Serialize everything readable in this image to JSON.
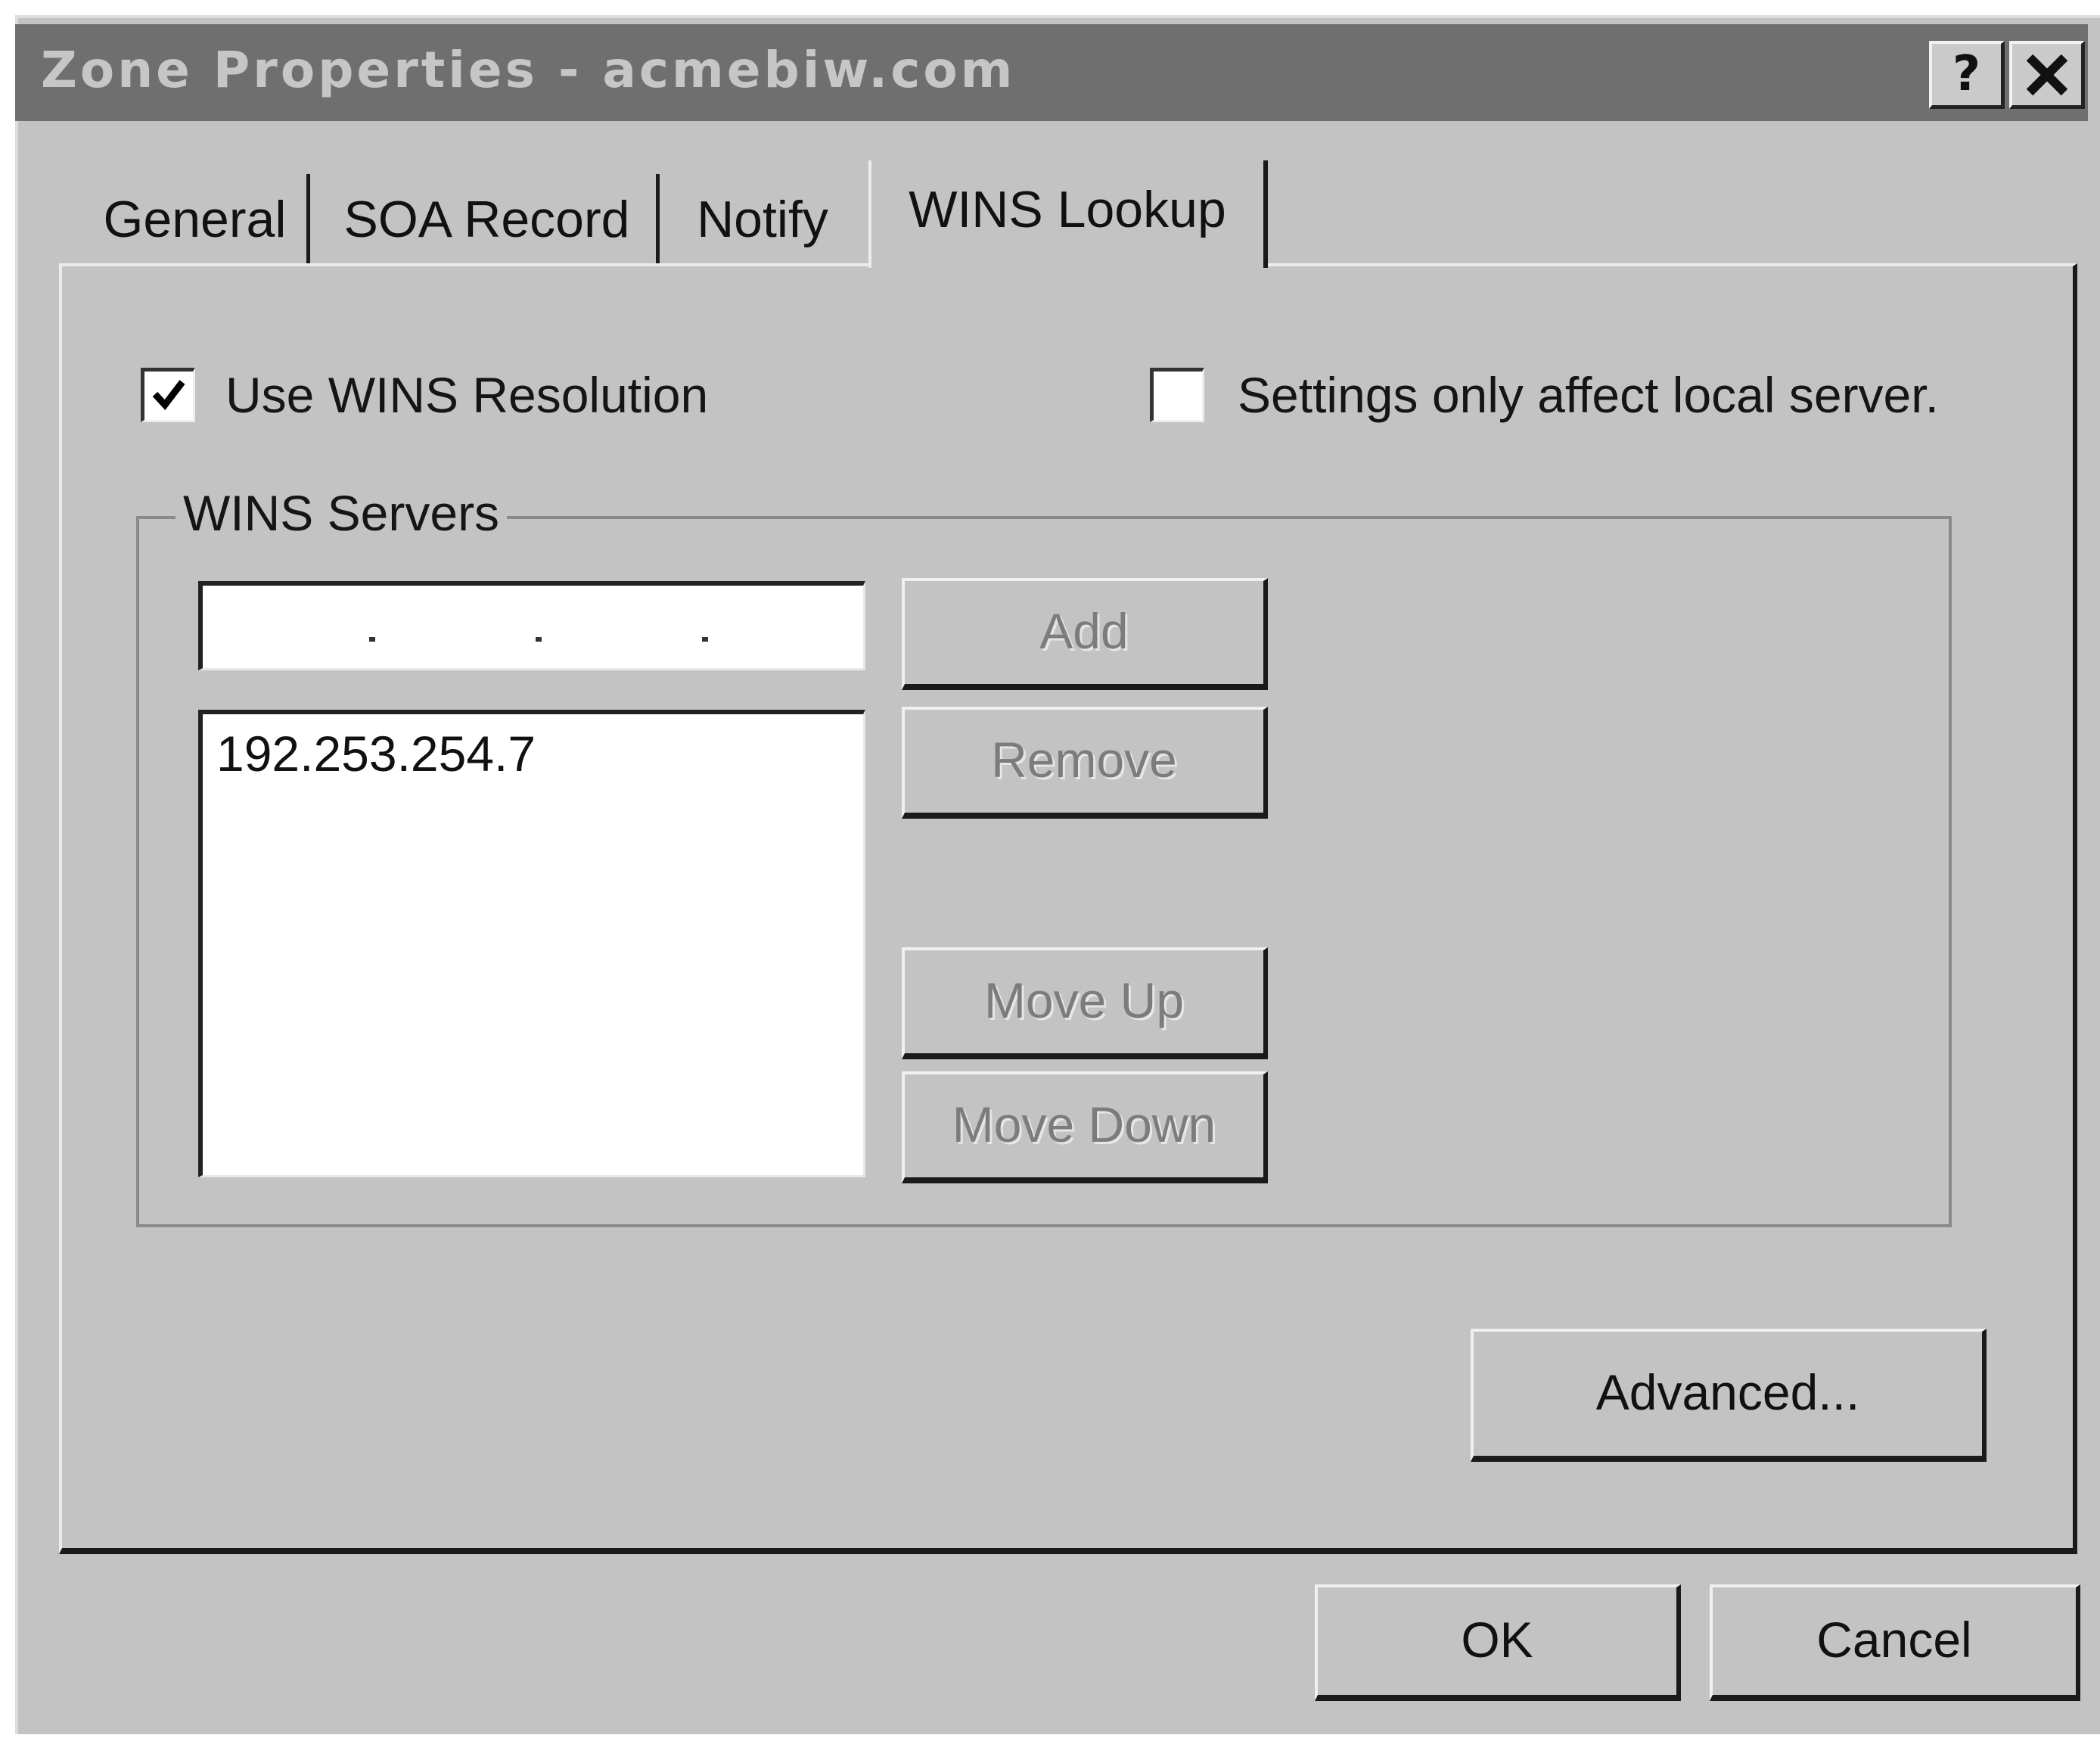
{
  "window": {
    "title": "Zone Properties - acmebiw.com",
    "help_button": "?",
    "close_button": "X"
  },
  "tabs": [
    {
      "label": "General",
      "active": false
    },
    {
      "label": "SOA Record",
      "active": false
    },
    {
      "label": "Notify",
      "active": false
    },
    {
      "label": "WINS Lookup",
      "active": true
    }
  ],
  "options": {
    "use_wins": {
      "label": "Use WINS Resolution",
      "checked": true
    },
    "local_only": {
      "label": "Settings only affect local server.",
      "checked": false
    }
  },
  "wins_servers": {
    "caption": "WINS Servers",
    "ip_input": "",
    "list": [
      "192.253.254.7"
    ],
    "add_label": "Add",
    "remove_label": "Remove",
    "move_up_label": "Move Up",
    "move_down_label": "Move Down"
  },
  "advanced_label": "Advanced...",
  "footer": {
    "ok_label": "OK",
    "cancel_label": "Cancel"
  }
}
